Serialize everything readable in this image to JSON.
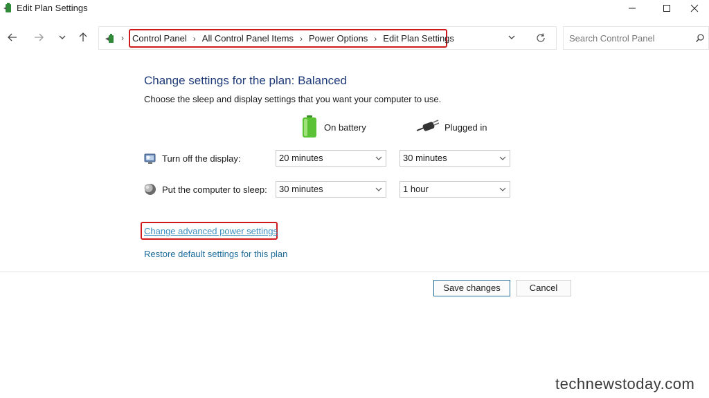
{
  "window": {
    "title": "Edit Plan Settings",
    "icon": "power-options-app-icon"
  },
  "nav": {
    "breadcrumbs": [
      "Control Panel",
      "All Control Panel Items",
      "Power Options",
      "Edit Plan Settings"
    ],
    "search_placeholder": "Search Control Panel"
  },
  "main": {
    "heading": "Change settings for the plan: Balanced",
    "subtext": "Choose the sleep and display settings that you want your computer to use.",
    "col_battery": "On battery",
    "col_plugged": "Plugged in",
    "rows": [
      {
        "label": "Turn off the display:",
        "battery": "20 minutes",
        "plugged": "30 minutes",
        "icon": "display-icon"
      },
      {
        "label": "Put the computer to sleep:",
        "battery": "30 minutes",
        "plugged": "1 hour",
        "icon": "sleep-moon-icon"
      }
    ],
    "link_advanced": "Change advanced power settings",
    "link_restore": "Restore default settings for this plan",
    "save_label": "Save changes",
    "cancel_label": "Cancel"
  },
  "watermark": "technewstoday.com",
  "colors": {
    "heading": "#1e3a78",
    "link": "#1a73a8",
    "highlight": "#d0191d"
  }
}
